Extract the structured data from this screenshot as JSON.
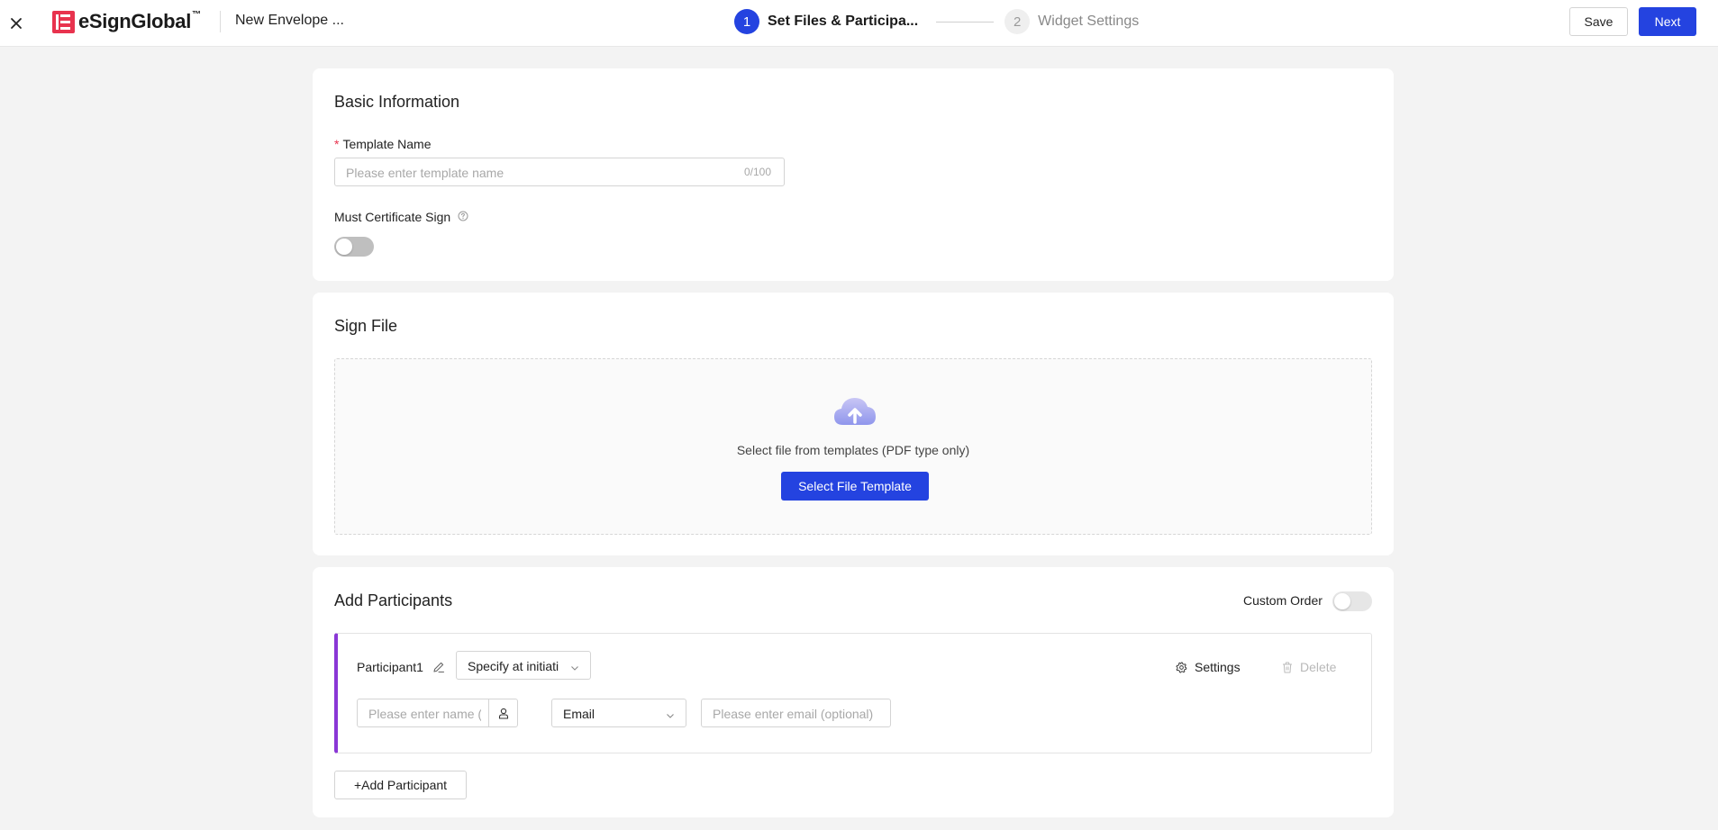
{
  "header": {
    "brand": "eSignGlobal",
    "brand_tm": "™",
    "envelope_title": "New Envelope ...",
    "steps": [
      {
        "number": "1",
        "label": "Set Files & Participa..."
      },
      {
        "number": "2",
        "label": "Widget Settings"
      }
    ],
    "save_label": "Save",
    "next_label": "Next"
  },
  "basic_info": {
    "title": "Basic Information",
    "template_name_label": "Template Name",
    "template_name_required": "*",
    "template_name_placeholder": "Please enter template name",
    "template_name_value": "",
    "template_name_counter": "0/100",
    "must_cert_label": "Must Certificate Sign",
    "must_cert_enabled": false
  },
  "sign_file": {
    "title": "Sign File",
    "hint": "Select file from templates (PDF type only)",
    "select_button": "Select File Template"
  },
  "participants": {
    "title": "Add Participants",
    "custom_order_label": "Custom Order",
    "custom_order_enabled": false,
    "items": [
      {
        "name": "Participant1",
        "role_value": "Specify at initiati",
        "settings_label": "Settings",
        "delete_label": "Delete",
        "name_placeholder": "Please enter name (op",
        "contact_type": "Email",
        "email_placeholder": "Please enter email (optional)"
      }
    ],
    "add_button": "+Add Participant"
  },
  "colors": {
    "primary": "#2443e0",
    "brand": "#e8334e",
    "participant_accent": "#8a37d6"
  }
}
